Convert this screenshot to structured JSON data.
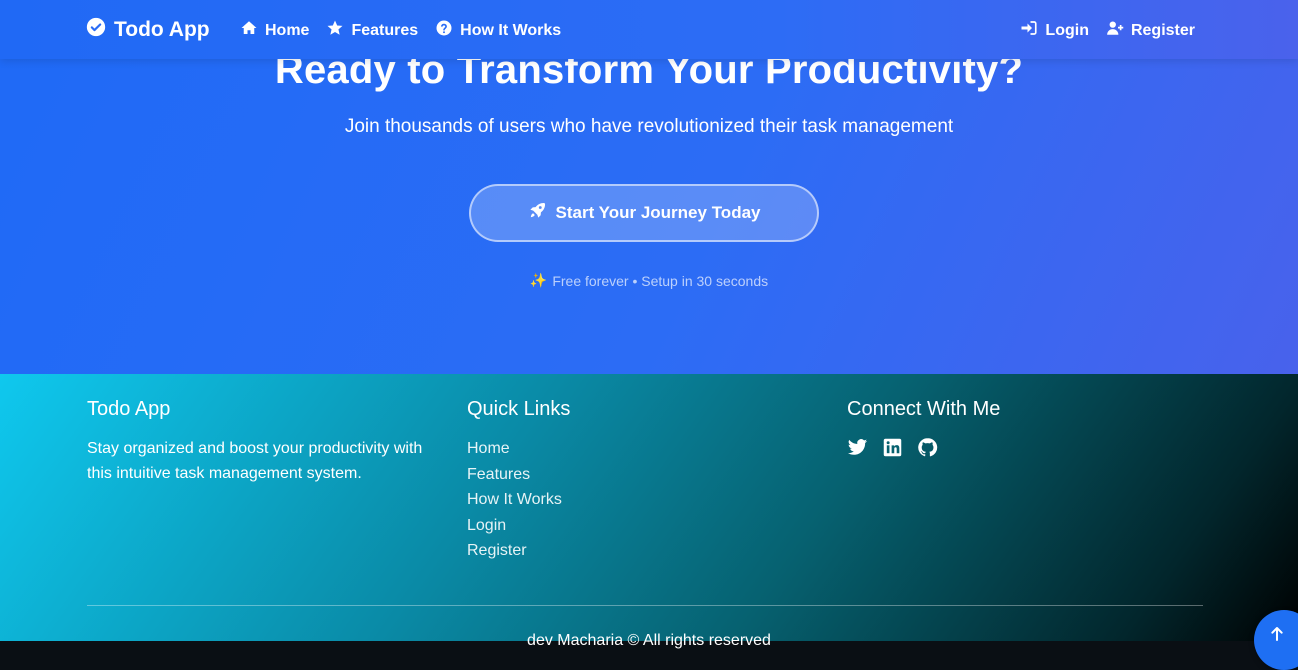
{
  "nav": {
    "brand": "Todo App",
    "brand_icon": "check-circle-icon",
    "left_items": [
      {
        "label": "Home",
        "icon": "home-icon"
      },
      {
        "label": "Features",
        "icon": "star-icon"
      },
      {
        "label": "How It Works",
        "icon": "question-circle-icon"
      }
    ],
    "right_items": [
      {
        "label": "Login",
        "icon": "sign-in-icon"
      },
      {
        "label": "Register",
        "icon": "user-plus-icon"
      }
    ]
  },
  "hero": {
    "title": "Ready to Transform Your Productivity?",
    "subtitle": "Join thousands of users who have revolutionized their task management",
    "cta_label": "Start Your Journey Today",
    "cta_icon": "rocket-icon",
    "note": "Free forever • Setup in 30 seconds",
    "note_icon": "sparkles-icon"
  },
  "footer": {
    "about": {
      "title": "Todo App",
      "text": "Stay organized and boost your productivity with this intuitive task management system."
    },
    "quick_links": {
      "title": "Quick Links",
      "items": [
        "Home",
        "Features",
        "How It Works",
        "Login",
        "Register"
      ]
    },
    "connect": {
      "title": "Connect With Me",
      "icons": [
        "twitter-icon",
        "linkedin-icon",
        "github-icon"
      ]
    },
    "copyright": "dev Macharia © All rights reserved"
  },
  "back_to_top_icon": "arrow-up-icon",
  "colors": {
    "hero_start": "#1f6af6",
    "hero_end": "#4862ec",
    "footer_start": "#0fc8ee",
    "footer_end": "#000000",
    "back_to_top": "#1e6ff3"
  }
}
